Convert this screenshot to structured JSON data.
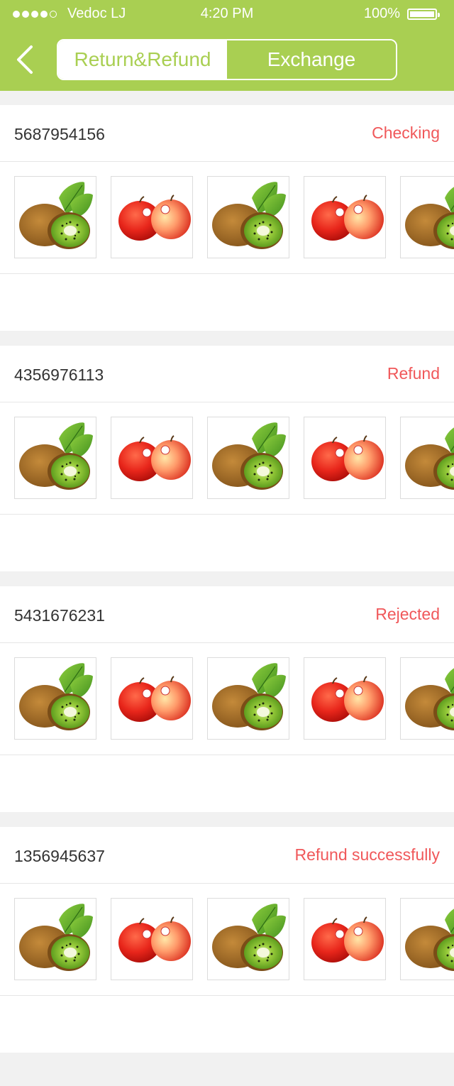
{
  "status_bar": {
    "carrier": "Vedoc LJ",
    "time": "4:20 PM",
    "battery": "100%",
    "signal_icon": "signal-dots-icon",
    "battery_icon": "battery-icon"
  },
  "nav": {
    "back_icon": "chevron-left-icon",
    "tabs": [
      {
        "label": "Return&Refund",
        "active": true
      },
      {
        "label": "Exchange",
        "active": false
      }
    ]
  },
  "colors": {
    "brand": "#a9cf52",
    "status": "#f0585a",
    "background": "#f1f1f1"
  },
  "orders": [
    {
      "id": "5687954156",
      "status": "Checking",
      "items": [
        "kiwi",
        "apple",
        "kiwi",
        "apple",
        "kiwi"
      ]
    },
    {
      "id": "4356976113",
      "status": "Refund",
      "items": [
        "kiwi",
        "apple",
        "kiwi",
        "apple",
        "kiwi"
      ]
    },
    {
      "id": "5431676231",
      "status": "Rejected",
      "items": [
        "kiwi",
        "apple",
        "kiwi",
        "apple",
        "kiwi"
      ]
    },
    {
      "id": "1356945637",
      "status": "Refund successfully",
      "items": [
        "kiwi",
        "apple",
        "kiwi",
        "apple",
        "kiwi"
      ]
    }
  ]
}
